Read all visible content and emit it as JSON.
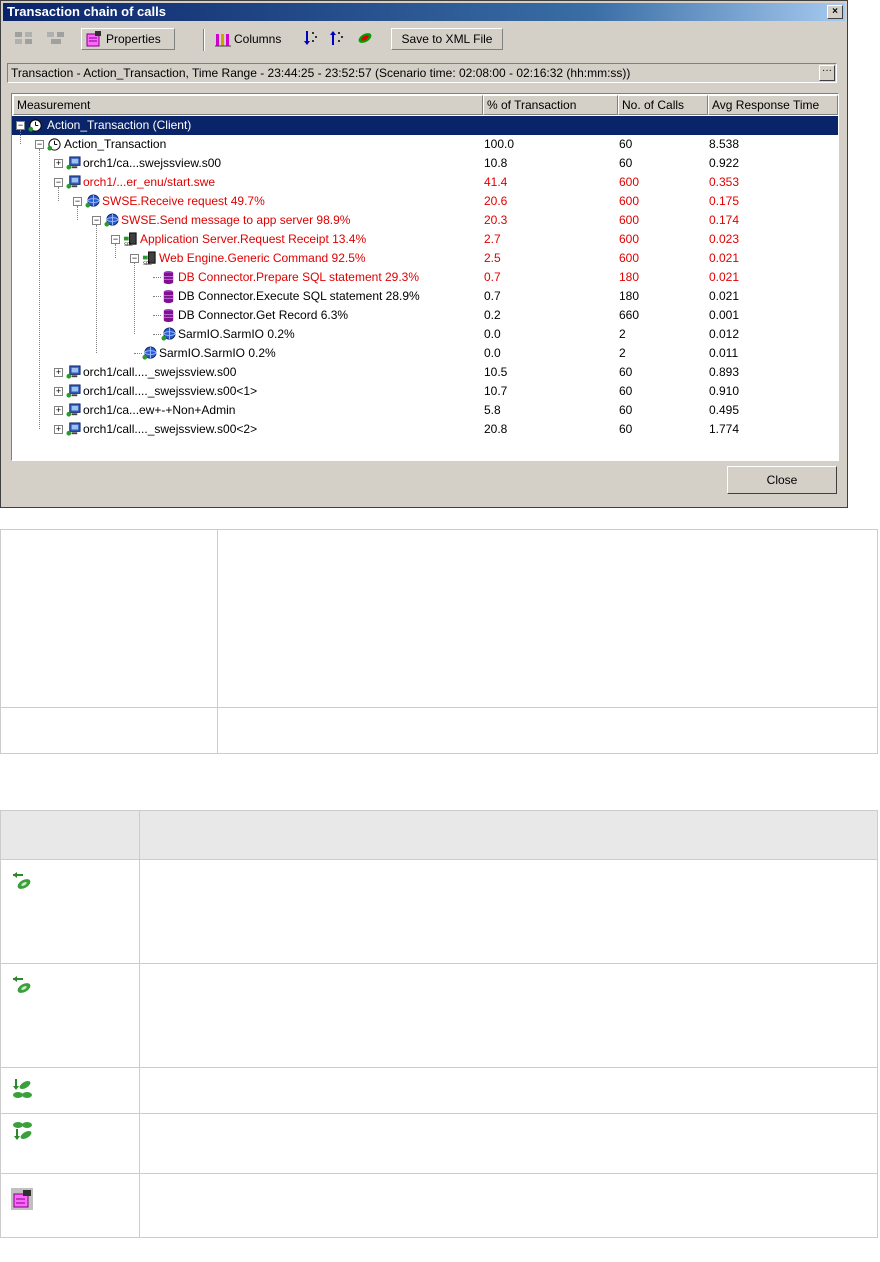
{
  "window": {
    "title": "Transaction chain of calls",
    "close_glyph": "×"
  },
  "toolbar": {
    "properties_label": "Properties",
    "columns_label": "Columns",
    "save_label": "Save to XML File"
  },
  "info_bar": {
    "text": "Transaction - Action_Transaction, Time Range - 23:44:25 - 23:52:57 (Scenario time: 02:08:00 - 02:16:32 (hh:mm:ss))",
    "more_glyph": "···"
  },
  "grid": {
    "columns": [
      "Measurement",
      "% of Transaction",
      "No. of Calls",
      "Avg Response Time"
    ],
    "rows": [
      {
        "label": "Action_Transaction (Client)",
        "pct": "",
        "calls": "",
        "avg": "",
        "selected": true,
        "red": false,
        "icon": "clock-icon"
      },
      {
        "label": "Action_Transaction",
        "pct": "100.0",
        "calls": "60",
        "avg": "8.538",
        "selected": false,
        "red": false,
        "icon": "clock-icon"
      },
      {
        "label": "orch1/ca...swejssview.s00",
        "pct": "10.8",
        "calls": "60",
        "avg": "0.922",
        "selected": false,
        "red": false,
        "icon": "web-server-icon"
      },
      {
        "label": "orch1/...er_enu/start.swe",
        "pct": "41.4",
        "calls": "600",
        "avg": "0.353",
        "selected": false,
        "red": true,
        "icon": "web-server-icon"
      },
      {
        "label": "SWSE.Receive request   49.7%",
        "pct": "20.6",
        "calls": "600",
        "avg": "0.175",
        "selected": false,
        "red": true,
        "icon": "globe-icon"
      },
      {
        "label": "SWSE.Send message to app server   98.9%",
        "pct": "20.3",
        "calls": "600",
        "avg": "0.174",
        "selected": false,
        "red": true,
        "icon": "globe-icon"
      },
      {
        "label": "Application Server.Request Receipt   13.4%",
        "pct": "2.7",
        "calls": "600",
        "avg": "0.023",
        "selected": false,
        "red": true,
        "icon": "sbl-server-icon"
      },
      {
        "label": "Web Engine.Generic Command   92.5%",
        "pct": "2.5",
        "calls": "600",
        "avg": "0.021",
        "selected": false,
        "red": true,
        "icon": "sbl-server-icon"
      },
      {
        "label": "DB Connector.Prepare SQL statement   29.3%",
        "pct": "0.7",
        "calls": "180",
        "avg": "0.021",
        "selected": false,
        "red": true,
        "icon": "database-icon"
      },
      {
        "label": "DB Connector.Execute SQL statement   28.9%",
        "pct": "0.7",
        "calls": "180",
        "avg": "0.021",
        "selected": false,
        "red": false,
        "icon": "database-icon"
      },
      {
        "label": "DB Connector.Get Record   6.3%",
        "pct": "0.2",
        "calls": "660",
        "avg": "0.001",
        "selected": false,
        "red": false,
        "icon": "database-icon"
      },
      {
        "label": "SarmIO.SarmIO   0.2%",
        "pct": "0.0",
        "calls": "2",
        "avg": "0.012",
        "selected": false,
        "red": false,
        "icon": "globe-icon"
      },
      {
        "label": "SarmIO.SarmIO   0.2%",
        "pct": "0.0",
        "calls": "2",
        "avg": "0.011",
        "selected": false,
        "red": false,
        "icon": "globe-icon"
      },
      {
        "label": "orch1/call...._swejssview.s00",
        "pct": "10.5",
        "calls": "60",
        "avg": "0.893",
        "selected": false,
        "red": false,
        "icon": "web-server-icon"
      },
      {
        "label": "orch1/call...._swejssview.s00<1>",
        "pct": "10.7",
        "calls": "60",
        "avg": "0.910",
        "selected": false,
        "red": false,
        "icon": "web-server-icon"
      },
      {
        "label": "orch1/ca...ew+-+Non+Admin",
        "pct": "5.8",
        "calls": "60",
        "avg": "0.495",
        "selected": false,
        "red": false,
        "icon": "web-server-icon"
      },
      {
        "label": "orch1/call...._swejssview.s00<2>",
        "pct": "20.8",
        "calls": "60",
        "avg": "1.774",
        "selected": false,
        "red": false,
        "icon": "web-server-icon"
      }
    ]
  },
  "close_button": "Close",
  "colors": {
    "dialog_bg": "#d4d0c8",
    "title_blue": "#0a246a",
    "critical_red": "#e00000",
    "table_header_bg": "#e8e8e8"
  },
  "lower_table": {
    "icons": [
      "back-arrow-leaf-icon",
      "back-arrow-leaf-icon",
      "down-leaves-icon",
      "leaves-icon",
      "properties-icon"
    ]
  }
}
